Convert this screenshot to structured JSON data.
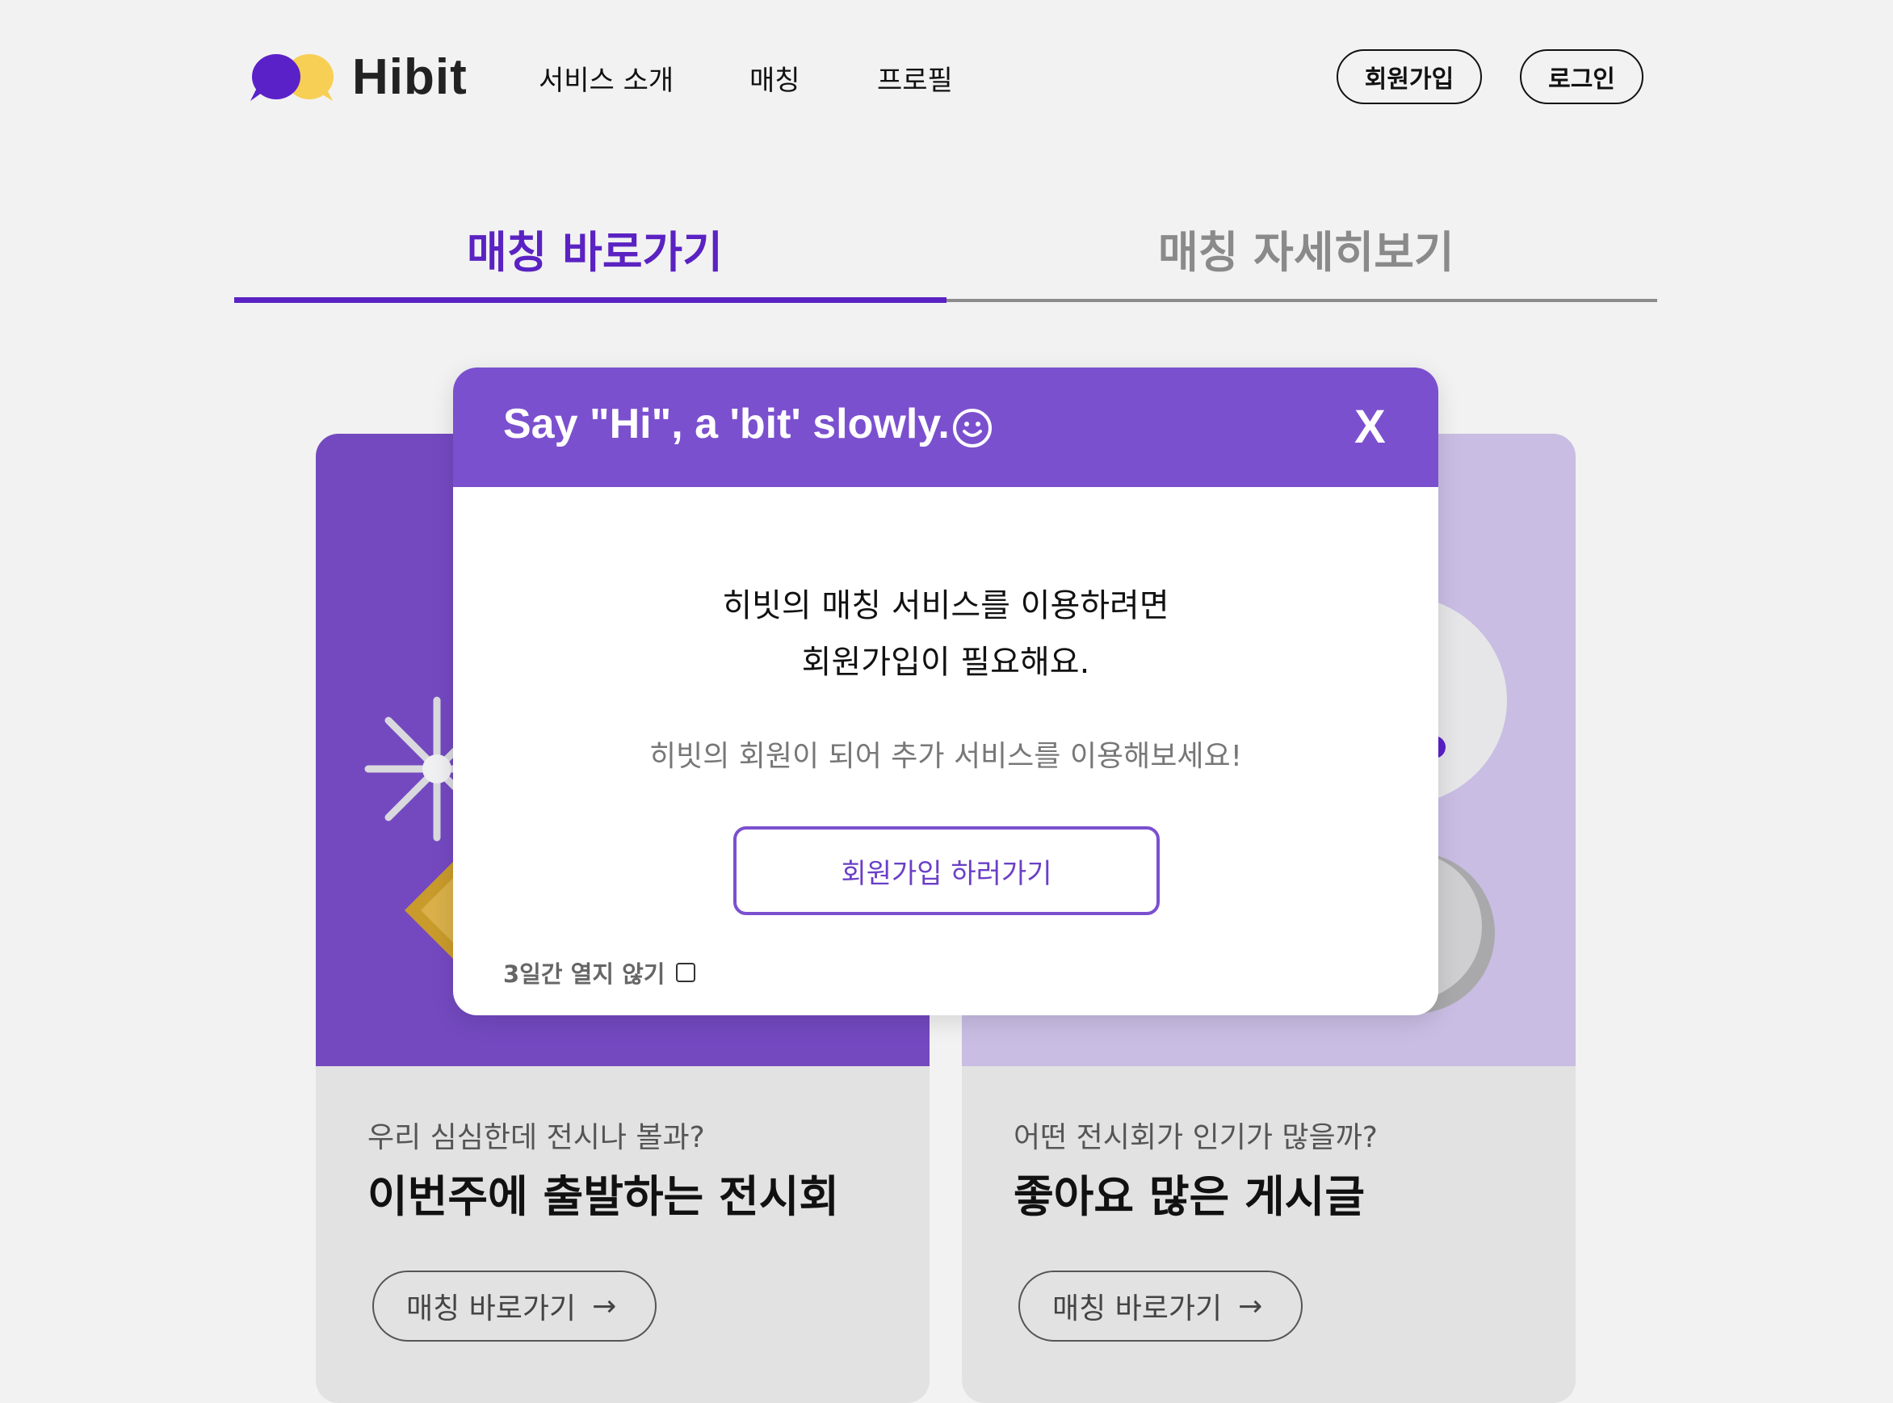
{
  "header": {
    "logo_text": "Hibit",
    "nav": [
      "서비스 소개",
      "매칭",
      "프로필"
    ],
    "signup_label": "회원가입",
    "login_label": "로그인"
  },
  "tabs": [
    {
      "label": "매칭 바로가기",
      "active": true
    },
    {
      "label": "매칭 자세히보기",
      "active": false
    }
  ],
  "cards": [
    {
      "subtitle": "우리 심심한데 전시나 볼과?",
      "title": "이번주에 출발하는 전시회",
      "button": "매칭 바로가기",
      "color": "#7449c0"
    },
    {
      "subtitle": "어떤 전시회가 인기가 많을까?",
      "title": "좋아요 많은 게시글",
      "button": "매칭 바로가기",
      "color": "#c9bde3"
    }
  ],
  "modal": {
    "title": "Say \"Hi\", a 'bit' slowly.",
    "close_label": "X",
    "message_line1": "히빗의 매칭 서비스를 이용하려면",
    "message_line2": "회원가입이 필요해요.",
    "sub_message": "히빗의 회원이 되어 추가 서비스를 이용해보세요!",
    "cta_label": "회원가입 하러가기",
    "dismiss_label": "3일간 열지 않기"
  },
  "colors": {
    "accent": "#5a22c2",
    "modal_header": "#7b50cf",
    "logo_purple": "#5b21c8",
    "logo_yellow": "#f7cf55"
  },
  "icons": {
    "arrow": "→",
    "smile": "smile-icon",
    "checkbox": "checkbox-unchecked"
  }
}
